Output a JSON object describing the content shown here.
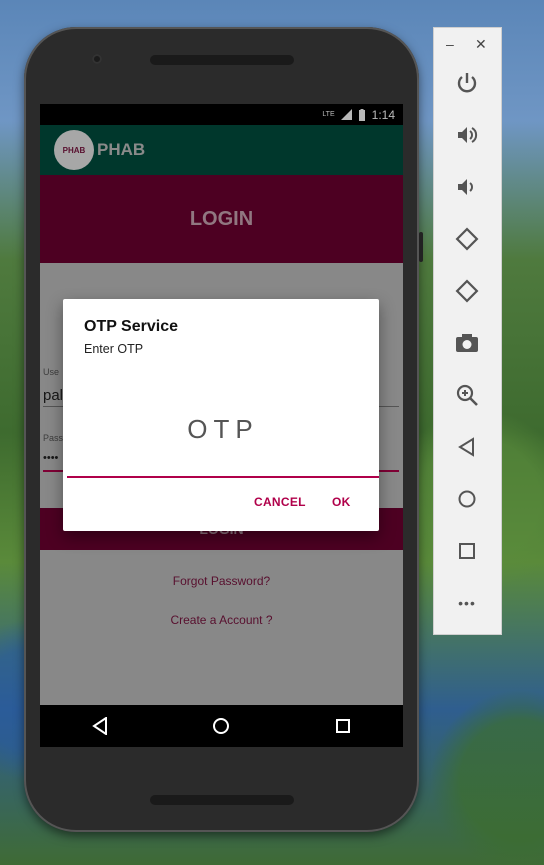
{
  "statusbar": {
    "network": "LTE",
    "time": "1:14"
  },
  "app": {
    "title": "PHAB",
    "logo_text": "PHAB"
  },
  "login": {
    "banner": "LOGIN",
    "username_label": "Use",
    "username_value": "pal",
    "password_label": "Pass",
    "password_value": "••••",
    "button_label": "LOGIN",
    "forgot_link": "Forgot Password?",
    "create_link": "Create a Account ?"
  },
  "dialog": {
    "title": "OTP Service",
    "message": "Enter OTP",
    "input_placeholder": "OTP",
    "cancel_label": "CANCEL",
    "ok_label": "OK"
  },
  "toolbar": {
    "minimize": "–",
    "close": "✕",
    "more": "•••",
    "items": [
      "power-icon",
      "volume-up-icon",
      "volume-down-icon",
      "rotate-left-icon",
      "rotate-right-icon",
      "camera-icon",
      "zoom-icon",
      "back-icon",
      "home-icon",
      "overview-icon",
      "more-icon"
    ]
  },
  "colors": {
    "primary_dark": "#004d3d",
    "accent": "#6b0030",
    "dialog_accent": "#b0004a"
  }
}
